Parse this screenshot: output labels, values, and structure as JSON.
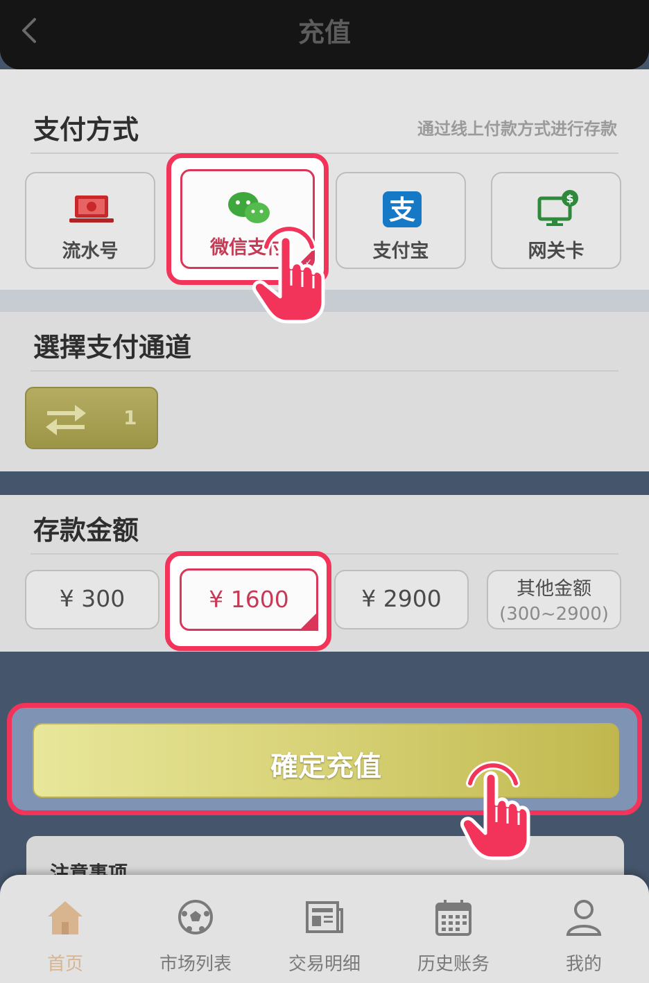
{
  "header": {
    "title": "充值"
  },
  "payment_section": {
    "heading": "支付方式",
    "hint": "通过线上付款方式进行存款",
    "methods": [
      {
        "label": "流水号",
        "icon": "laptop-money-icon",
        "selected": false
      },
      {
        "label": "微信支付",
        "icon": "wechat-icon",
        "selected": true
      },
      {
        "label": "支付宝",
        "icon": "alipay-icon",
        "selected": false
      },
      {
        "label": "网关卡",
        "icon": "monitor-dollar-icon",
        "selected": false
      }
    ]
  },
  "channel_section": {
    "heading": "選擇支付通道",
    "channel_number": "1"
  },
  "amount_section": {
    "heading": "存款金额",
    "amounts": [
      {
        "label": "¥ 300",
        "selected": false
      },
      {
        "label": "¥ 1600",
        "selected": true
      },
      {
        "label": "¥ 2900",
        "selected": false
      }
    ],
    "other": {
      "label": "其他金额",
      "range": "(300~2900)"
    }
  },
  "confirm": {
    "label": "確定充值"
  },
  "notice": {
    "title": "注意事项"
  },
  "tabbar": {
    "items": [
      {
        "label": "首页",
        "icon": "home-icon",
        "active": true
      },
      {
        "label": "市场列表",
        "icon": "soccer-ball-icon",
        "active": false
      },
      {
        "label": "交易明细",
        "icon": "newspaper-icon",
        "active": false
      },
      {
        "label": "历史账务",
        "icon": "calendar-icon",
        "active": false
      },
      {
        "label": "我的",
        "icon": "user-icon",
        "active": false
      }
    ]
  },
  "colors": {
    "highlight": "#f2335a",
    "confirm_gold": "#d9d47a",
    "active_tab": "#d8b48f",
    "wechat_green": "#3fa83c",
    "alipay_blue": "#1679c6"
  }
}
